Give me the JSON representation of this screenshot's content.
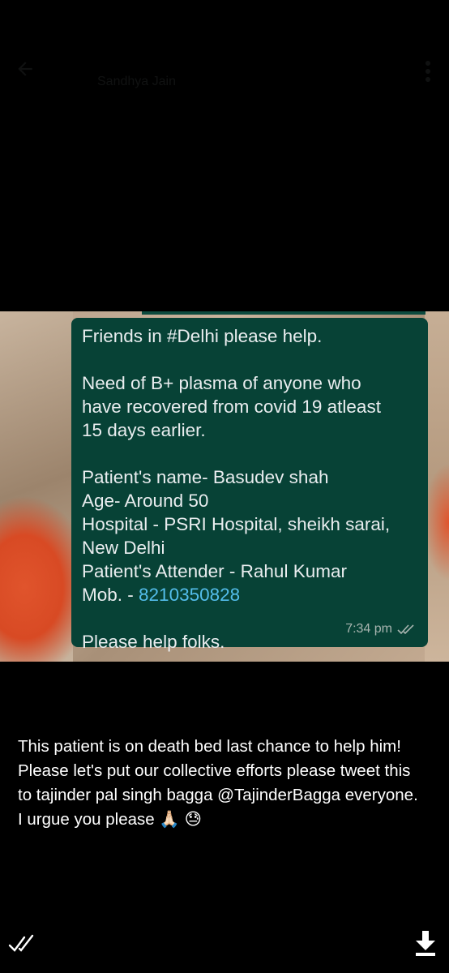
{
  "header": {
    "title": "Sandhya Jain",
    "back_icon": "arrow-left-icon",
    "menu_icon": "more-vert-icon"
  },
  "image": {
    "message_lines": [
      "Friends in #Delhi please help.",
      "",
      "Need of B+ plasma of anyone who",
      "have recovered from covid 19 atleast",
      "15 days earlier.",
      "",
      "Patient's name- Basudev shah",
      "Age- Around 50",
      "Hospital - PSRI Hospital, sheikh sarai,",
      "New Delhi",
      "Patient's Attender -  Rahul Kumar"
    ],
    "mobile_label": "Mob. - ",
    "mobile_number": "8210350828",
    "closing_line": "Please help folks.",
    "time": "7:34 pm",
    "bubble_color": "#074236",
    "link_color": "#53bdeb"
  },
  "caption": {
    "text": "This patient is on death bed last chance to help him! Please let's put our collective efforts please tweet this to tajinder pal singh bagga @TajinderBagga everyone. I urgue you please 🙏🏻 😓"
  },
  "controls": {
    "read_icon": "double-check-icon",
    "download_icon": "download-icon"
  }
}
